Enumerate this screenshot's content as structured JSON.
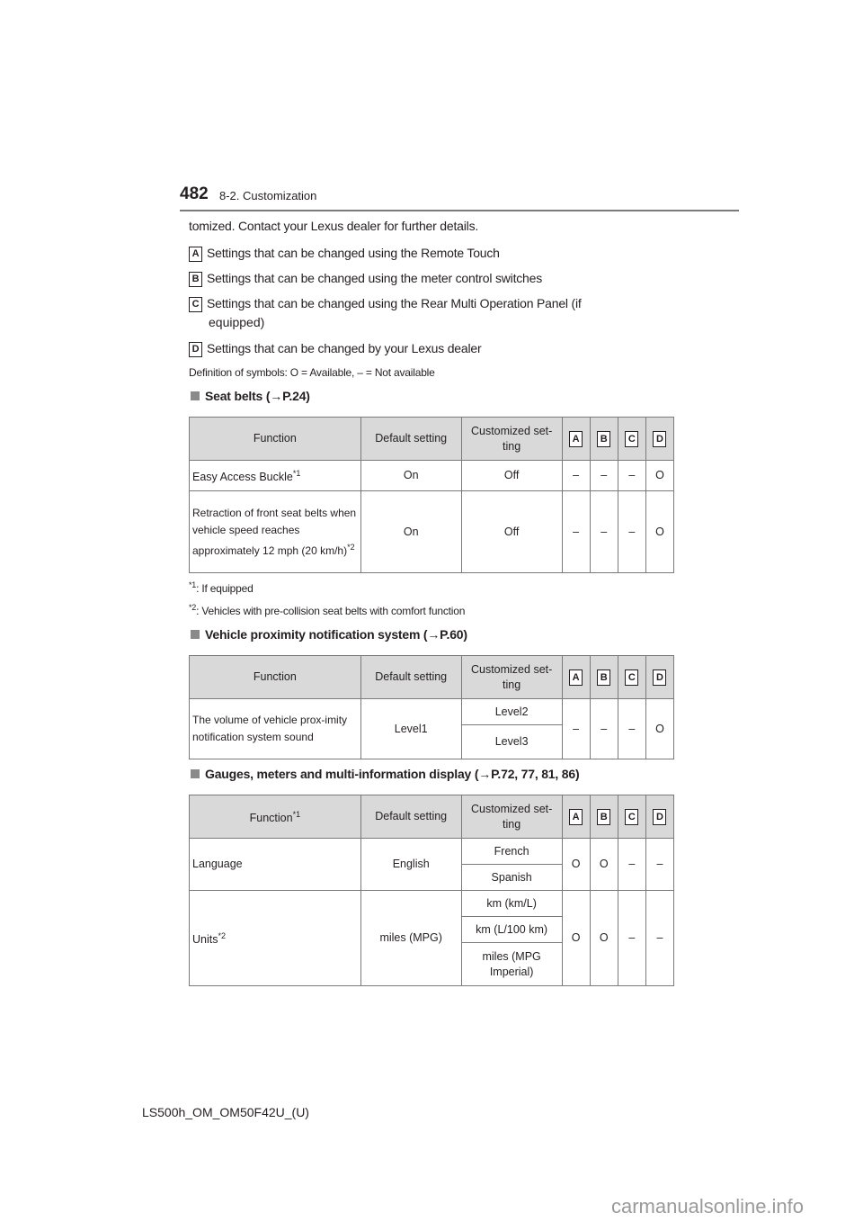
{
  "header": {
    "page_number": "482",
    "section": "8-2. Customization"
  },
  "intro_text": "tomized. Contact your Lexus dealer for further details.",
  "legend": [
    {
      "key": "A",
      "text": "Settings that can be changed using the Remote Touch"
    },
    {
      "key": "B",
      "text": "Settings that can be changed using the meter control switches"
    },
    {
      "key": "C",
      "text": "Settings that can be changed using the Rear Multi Operation Panel (if",
      "text_cont": "equipped)"
    },
    {
      "key": "D",
      "text": "Settings that can be changed by your Lexus dealer"
    }
  ],
  "definitions": "Definition of symbols: O = Available, – = Not available",
  "columns": {
    "function": "Function",
    "default": "Default setting",
    "custom": "Customized set-ting",
    "a": "A",
    "b": "B",
    "c": "C",
    "d": "D"
  },
  "sections": [
    {
      "title": "Seat belts (→P.24)",
      "rows": [
        {
          "function": "Easy Access Buckle",
          "sup": "*1",
          "default": "On",
          "custom": "Off",
          "a": "–",
          "b": "–",
          "c": "–",
          "d": "O"
        },
        {
          "function": "Retraction of front seat belts when vehicle speed reaches approximately 12 mph (20 km/h)",
          "sup": "*2",
          "default": "On",
          "custom": "Off",
          "a": "–",
          "b": "–",
          "c": "–",
          "d": "O"
        }
      ],
      "footnotes": [
        {
          "mark": "*1",
          "text": ":  If equipped"
        },
        {
          "mark": "*2",
          "text": ": Vehicles with pre-collision seat belts with comfort function"
        }
      ]
    },
    {
      "title": "Vehicle proximity notification system (→P.60)",
      "rows": [
        {
          "function": "The volume of vehicle prox-imity notification system sound",
          "default": "Level1",
          "custom": [
            "Level2",
            "Level3"
          ],
          "a": "–",
          "b": "–",
          "c": "–",
          "d": "O"
        }
      ]
    },
    {
      "title": "Gauges, meters and multi-information display (→P.72, 77, 81, 86)",
      "function_sup": "*1",
      "rows": [
        {
          "function": "Language",
          "default": "English",
          "custom": [
            "French",
            "Spanish"
          ],
          "a": "O",
          "b": "O",
          "c": "–",
          "d": "–"
        },
        {
          "function": "Units",
          "sup": "*2",
          "default": "miles (MPG)",
          "custom": [
            "km (km/L)",
            "km (L/100 km)",
            "miles (MPG Imperial)"
          ],
          "a": "O",
          "b": "O",
          "c": "–",
          "d": "–"
        }
      ]
    }
  ],
  "footer": {
    "doc_id": "LS500h_OM_OM50F42U_(U)",
    "watermark": "carmanualsonline.info"
  }
}
